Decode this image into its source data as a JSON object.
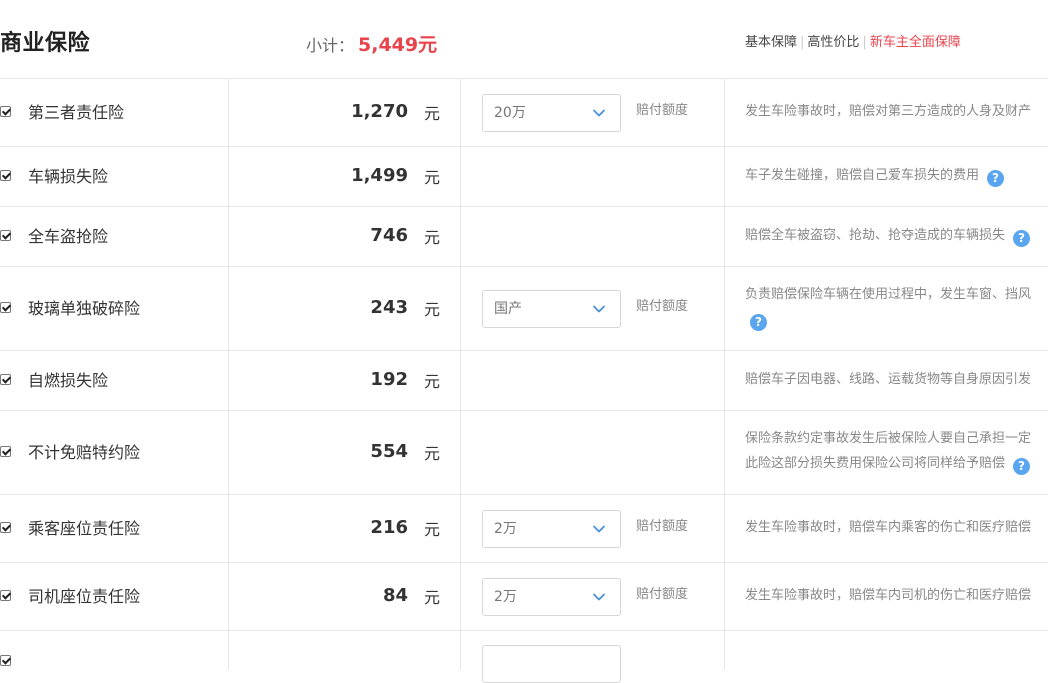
{
  "header": {
    "title": "商业保险",
    "subtotal_label": "小计：",
    "subtotal_value": "5,449元",
    "plans": [
      "基本保障",
      "高性价比",
      "新车主全面保障"
    ],
    "accent_color": "#e8444b"
  },
  "rows": [
    {
      "name": "第三者责任险",
      "checked": true,
      "price": "1,270",
      "unit": "元",
      "select_value": "20万",
      "coverage_label": "赔付额度",
      "desc": [
        "发生车险事故时，赔偿对第三方造成的人身及财产"
      ],
      "help": false
    },
    {
      "name": "车辆损失险",
      "checked": true,
      "price": "1,499",
      "unit": "元",
      "desc": [
        "车子发生碰撞，赔偿自己爱车损失的费用"
      ],
      "help": true
    },
    {
      "name": "全车盗抢险",
      "checked": true,
      "price": "746",
      "unit": "元",
      "desc": [
        "赔偿全车被盗窃、抢劫、抢夺造成的车辆损失"
      ],
      "help": true
    },
    {
      "name": "玻璃单独破碎险",
      "checked": true,
      "price": "243",
      "unit": "元",
      "select_value": "国产",
      "coverage_label": "赔付额度",
      "desc": [
        "负责赔偿保险车辆在使用过程中，发生车窗、挡风",
        ""
      ],
      "help": true
    },
    {
      "name": "自燃损失险",
      "checked": true,
      "price": "192",
      "unit": "元",
      "desc": [
        "赔偿车子因电器、线路、运载货物等自身原因引发"
      ],
      "help": false
    },
    {
      "name": "不计免赔特约险",
      "checked": true,
      "price": "554",
      "unit": "元",
      "desc": [
        "保险条款约定事故发生后被保险人要自己承担一定",
        "此险这部分损失费用保险公司将同样给予赔偿"
      ],
      "help": true
    },
    {
      "name": "乘客座位责任险",
      "checked": true,
      "price": "216",
      "unit": "元",
      "select_value": "2万",
      "coverage_label": "赔付额度",
      "desc": [
        "发生车险事故时，赔偿车内乘客的伤亡和医疗赔偿"
      ],
      "help": false
    },
    {
      "name": "司机座位责任险",
      "checked": true,
      "price": "84",
      "unit": "元",
      "select_value": "2万",
      "coverage_label": "赔付额度",
      "desc": [
        "发生车险事故时，赔偿车内司机的伤亡和医疗赔偿"
      ],
      "help": false
    }
  ]
}
